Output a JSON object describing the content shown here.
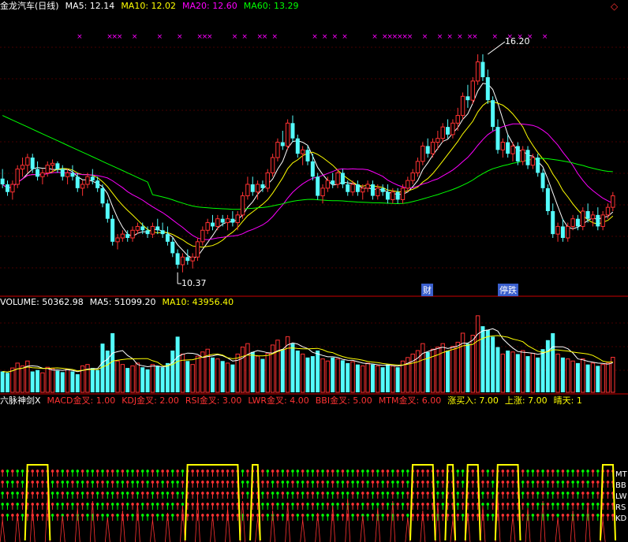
{
  "colors": {
    "bg": "#000000",
    "grid": "#8B0000",
    "up": "#FF3232",
    "down": "#54FCFC",
    "ma5": "#FFFFFF",
    "ma10": "#FFFF00",
    "ma20": "#FF00FF",
    "ma60": "#00FF00",
    "separator": "#CC0000",
    "marker": "#FF00FF",
    "tag": "#3A5FCD"
  },
  "price_header": {
    "stock": "金龙汽车(日线)",
    "ma5": "MA5: 12.14",
    "ma10": "MA10: 12.02",
    "ma20": "MA20: 12.60",
    "ma60": "MA60: 13.29"
  },
  "volume_header": {
    "volume": "VOLUME: 50362.98",
    "ma5": "MA5: 51099.20",
    "ma10": "MA10: 43956.40"
  },
  "indicator_header": {
    "name": "六脉神剑X",
    "macd": "MACD金叉: 1.00",
    "kdj": "KDJ金叉: 2.00",
    "rsi": "RSI金叉: 3.00",
    "lwr": "LWR金叉: 4.00",
    "bbi": "BBI金叉: 5.00",
    "mtm": "MTM金叉: 6.00",
    "buy": "涨买入: 7.00",
    "up": "上涨: 7.00",
    "sunny": "晴天: 1"
  },
  "annotations": {
    "high_label": "16.20",
    "low_label": "10.37",
    "tag1": "财",
    "tag2": "停跌"
  },
  "right_labels": [
    "MT",
    "BB",
    "LW",
    "RS",
    "KD"
  ],
  "chart_data": [
    {
      "type": "candlestick",
      "title": "金龙汽车(日线)",
      "n_bars": 128,
      "y_range": [
        10.0,
        17.0
      ],
      "highest": 16.2,
      "lowest": 10.37,
      "bars": [
        [
          12.95,
          13.2,
          12.7,
          12.8
        ],
        [
          12.8,
          12.9,
          12.5,
          12.6
        ],
        [
          12.6,
          12.9,
          12.4,
          12.8
        ],
        [
          12.8,
          13.3,
          12.7,
          13.2
        ],
        [
          13.2,
          13.5,
          13.0,
          13.3
        ],
        [
          13.3,
          13.6,
          13.1,
          13.5
        ],
        [
          13.5,
          13.6,
          13.1,
          13.2
        ],
        [
          13.2,
          13.4,
          12.9,
          13.0
        ],
        [
          13.0,
          13.2,
          12.8,
          13.1
        ],
        [
          13.1,
          13.4,
          13.0,
          13.3
        ],
        [
          13.3,
          13.45,
          13.1,
          13.35
        ],
        [
          13.35,
          13.4,
          13.1,
          13.2
        ],
        [
          13.2,
          13.3,
          12.9,
          13.0
        ],
        [
          13.0,
          13.2,
          12.8,
          13.1
        ],
        [
          13.1,
          13.3,
          12.9,
          13.0
        ],
        [
          13.0,
          13.1,
          12.6,
          12.7
        ],
        [
          12.7,
          12.9,
          12.5,
          12.8
        ],
        [
          12.8,
          13.1,
          12.7,
          13.0
        ],
        [
          13.0,
          13.2,
          12.8,
          12.9
        ],
        [
          12.9,
          13.0,
          12.6,
          12.7
        ],
        [
          12.7,
          12.8,
          12.2,
          12.3
        ],
        [
          12.3,
          12.4,
          11.8,
          11.9
        ],
        [
          11.9,
          12.0,
          11.2,
          11.3
        ],
        [
          11.3,
          11.5,
          11.1,
          11.4
        ],
        [
          11.4,
          11.6,
          11.3,
          11.5
        ],
        [
          11.5,
          11.6,
          11.3,
          11.4
        ],
        [
          11.4,
          11.7,
          11.3,
          11.6
        ],
        [
          11.6,
          11.8,
          11.5,
          11.7
        ],
        [
          11.7,
          11.8,
          11.5,
          11.6
        ],
        [
          11.6,
          11.7,
          11.4,
          11.5
        ],
        [
          11.5,
          11.8,
          11.4,
          11.7
        ],
        [
          11.7,
          11.9,
          11.5,
          11.6
        ],
        [
          11.6,
          11.8,
          11.4,
          11.5
        ],
        [
          11.5,
          11.7,
          11.2,
          11.3
        ],
        [
          11.3,
          11.4,
          10.9,
          11.0
        ],
        [
          11.0,
          11.1,
          10.6,
          10.7
        ],
        [
          10.7,
          11.0,
          10.5,
          10.9
        ],
        [
          10.9,
          11.1,
          10.7,
          10.8
        ],
        [
          10.8,
          11.0,
          10.6,
          10.9
        ],
        [
          10.9,
          11.4,
          10.8,
          11.3
        ],
        [
          11.3,
          11.7,
          11.2,
          11.6
        ],
        [
          11.6,
          11.9,
          11.5,
          11.8
        ],
        [
          11.8,
          12.0,
          11.6,
          11.7
        ],
        [
          11.7,
          12.0,
          11.6,
          11.9
        ],
        [
          11.9,
          12.0,
          11.7,
          11.8
        ],
        [
          11.8,
          12.0,
          11.6,
          11.9
        ],
        [
          11.9,
          12.1,
          11.7,
          11.8
        ],
        [
          11.8,
          12.1,
          11.6,
          12.0
        ],
        [
          12.0,
          12.6,
          11.9,
          12.5
        ],
        [
          12.5,
          13.0,
          12.4,
          12.8
        ],
        [
          12.8,
          13.0,
          12.5,
          12.6
        ],
        [
          12.6,
          12.9,
          12.4,
          12.8
        ],
        [
          12.8,
          12.9,
          12.6,
          12.7
        ],
        [
          12.7,
          13.2,
          12.6,
          13.1
        ],
        [
          13.1,
          13.6,
          13.0,
          13.5
        ],
        [
          13.5,
          14.0,
          13.4,
          13.9
        ],
        [
          13.9,
          14.2,
          13.7,
          13.8
        ],
        [
          13.8,
          14.5,
          13.7,
          14.4
        ],
        [
          14.4,
          14.6,
          13.9,
          14.0
        ],
        [
          14.0,
          14.1,
          13.5,
          13.6
        ],
        [
          13.6,
          13.8,
          13.3,
          13.7
        ],
        [
          13.7,
          13.8,
          13.3,
          13.4
        ],
        [
          13.4,
          13.6,
          12.9,
          13.0
        ],
        [
          13.0,
          13.1,
          12.4,
          12.5
        ],
        [
          12.5,
          12.8,
          12.3,
          12.7
        ],
        [
          12.7,
          13.0,
          12.6,
          12.9
        ],
        [
          12.9,
          13.1,
          12.7,
          12.8
        ],
        [
          12.8,
          13.2,
          12.7,
          13.1
        ],
        [
          13.1,
          13.2,
          12.7,
          12.8
        ],
        [
          12.8,
          12.9,
          12.5,
          12.6
        ],
        [
          12.6,
          12.9,
          12.5,
          12.8
        ],
        [
          12.8,
          12.9,
          12.5,
          12.6
        ],
        [
          12.6,
          12.8,
          12.4,
          12.7
        ],
        [
          12.7,
          12.9,
          12.6,
          12.8
        ],
        [
          12.8,
          12.9,
          12.4,
          12.5
        ],
        [
          12.5,
          12.8,
          12.4,
          12.7
        ],
        [
          12.7,
          12.8,
          12.5,
          12.6
        ],
        [
          12.6,
          12.8,
          12.3,
          12.4
        ],
        [
          12.4,
          12.7,
          12.3,
          12.6
        ],
        [
          12.6,
          12.7,
          12.3,
          12.4
        ],
        [
          12.4,
          12.8,
          12.3,
          12.7
        ],
        [
          12.7,
          13.0,
          12.6,
          12.9
        ],
        [
          12.9,
          13.2,
          12.8,
          13.1
        ],
        [
          13.1,
          13.5,
          13.0,
          13.4
        ],
        [
          13.4,
          13.9,
          13.3,
          13.8
        ],
        [
          13.8,
          14.0,
          13.5,
          13.6
        ],
        [
          13.6,
          14.0,
          13.5,
          13.9
        ],
        [
          13.9,
          14.2,
          13.7,
          14.0
        ],
        [
          14.0,
          14.4,
          13.9,
          14.3
        ],
        [
          14.3,
          14.5,
          14.0,
          14.1
        ],
        [
          14.1,
          14.5,
          14.0,
          14.4
        ],
        [
          14.4,
          14.8,
          14.2,
          14.6
        ],
        [
          14.6,
          15.2,
          14.5,
          15.1
        ],
        [
          15.1,
          15.4,
          14.8,
          15.0
        ],
        [
          15.0,
          15.6,
          14.9,
          15.5
        ],
        [
          15.5,
          16.2,
          15.4,
          16.0
        ],
        [
          16.0,
          16.2,
          15.5,
          15.6
        ],
        [
          15.6,
          15.8,
          14.9,
          15.0
        ],
        [
          15.0,
          15.1,
          14.2,
          14.3
        ],
        [
          14.3,
          14.5,
          13.6,
          13.7
        ],
        [
          13.7,
          14.0,
          13.5,
          13.9
        ],
        [
          13.9,
          14.1,
          13.5,
          13.6
        ],
        [
          13.6,
          13.9,
          13.4,
          13.8
        ],
        [
          13.8,
          13.9,
          13.3,
          13.4
        ],
        [
          13.4,
          13.8,
          13.3,
          13.7
        ],
        [
          13.7,
          13.8,
          13.2,
          13.3
        ],
        [
          13.3,
          13.6,
          13.2,
          13.5
        ],
        [
          13.5,
          13.6,
          13.0,
          13.1
        ],
        [
          13.1,
          13.2,
          12.6,
          12.7
        ],
        [
          12.7,
          12.8,
          12.0,
          12.1
        ],
        [
          12.1,
          12.3,
          11.4,
          11.5
        ],
        [
          11.5,
          11.8,
          11.3,
          11.7
        ],
        [
          11.7,
          11.9,
          11.3,
          11.4
        ],
        [
          11.4,
          11.8,
          11.3,
          11.7
        ],
        [
          11.7,
          12.0,
          11.6,
          11.9
        ],
        [
          11.9,
          12.0,
          11.6,
          11.7
        ],
        [
          11.7,
          12.2,
          11.6,
          12.1
        ],
        [
          12.1,
          12.3,
          11.8,
          11.9
        ],
        [
          11.9,
          12.1,
          11.7,
          12.0
        ],
        [
          12.0,
          12.2,
          11.6,
          11.7
        ],
        [
          11.7,
          12.1,
          11.6,
          12.0
        ],
        [
          12.0,
          12.3,
          11.9,
          12.2
        ],
        [
          12.2,
          12.6,
          12.1,
          12.5
        ]
      ],
      "series": [
        {
          "name": "MA5",
          "values": [
            12.14,
            12.14,
            12.14,
            12.14,
            12.14,
            12.14,
            12.14,
            12.14
          ]
        },
        {
          "name": "MA10",
          "values": [
            12.02,
            12.02,
            12.02,
            12.02,
            12.02,
            12.02,
            12.02,
            12.02
          ]
        },
        {
          "name": "MA20",
          "values": [
            12.6,
            12.6,
            12.6,
            12.6,
            12.6,
            12.6,
            12.6,
            12.6
          ]
        },
        {
          "name": "MA60",
          "values": [
            13.29,
            13.29,
            13.29,
            13.29,
            13.29,
            13.29,
            13.29,
            13.29
          ]
        }
      ]
    },
    {
      "type": "bar",
      "title": "VOLUME",
      "y_range": [
        0,
        120000
      ],
      "values": [
        30000,
        28000,
        35000,
        42000,
        38000,
        45000,
        30000,
        32000,
        28000,
        36000,
        34000,
        31000,
        29000,
        33000,
        30000,
        26000,
        38000,
        40000,
        35000,
        32000,
        70000,
        60000,
        85000,
        45000,
        40000,
        35000,
        38000,
        42000,
        36000,
        33000,
        40000,
        38000,
        36000,
        42000,
        60000,
        80000,
        55000,
        45000,
        40000,
        52000,
        58000,
        62000,
        50000,
        48000,
        45000,
        42000,
        40000,
        55000,
        65000,
        70000,
        58000,
        52000,
        48000,
        56000,
        68000,
        75000,
        62000,
        80000,
        70000,
        60000,
        55000,
        50000,
        52000,
        60000,
        48000,
        45000,
        50000,
        48000,
        46000,
        42000,
        44000,
        40000,
        38000,
        42000,
        40000,
        38000,
        36000,
        40000,
        38000,
        36000,
        45000,
        50000,
        55000,
        60000,
        70000,
        58000,
        62000,
        65000,
        70000,
        60000,
        66000,
        72000,
        85000,
        70000,
        82000,
        110000,
        95000,
        90000,
        80000,
        65000,
        55000,
        60000,
        58000,
        55000,
        60000,
        52000,
        56000,
        50000,
        62000,
        75000,
        85000,
        55000,
        50000,
        48000,
        45000,
        42000,
        48000,
        40000,
        42000,
        38000,
        40000,
        42000,
        50362.98
      ],
      "series": [
        {
          "name": "MA5",
          "values": [
            51099.2
          ]
        },
        {
          "name": "MA10",
          "values": [
            43956.4
          ]
        }
      ]
    },
    {
      "type": "table",
      "title": "六脉神剑X",
      "series": [
        {
          "name": "MACD金叉",
          "values": [
            1.0
          ]
        },
        {
          "name": "KDJ金叉",
          "values": [
            2.0
          ]
        },
        {
          "name": "RSI金叉",
          "values": [
            3.0
          ]
        },
        {
          "name": "LWR金叉",
          "values": [
            4.0
          ]
        },
        {
          "name": "BBI金叉",
          "values": [
            5.0
          ]
        },
        {
          "name": "MTM金叉",
          "values": [
            6.0
          ]
        },
        {
          "name": "涨买入",
          "values": [
            7.0
          ]
        },
        {
          "name": "上涨",
          "values": [
            7.0
          ]
        }
      ],
      "buy_zones": [
        [
          5,
          9
        ],
        [
          37,
          47
        ],
        [
          50,
          51
        ],
        [
          82,
          86
        ],
        [
          89,
          90
        ],
        [
          93,
          95
        ],
        [
          99,
          103
        ],
        [
          120,
          122
        ]
      ]
    }
  ]
}
